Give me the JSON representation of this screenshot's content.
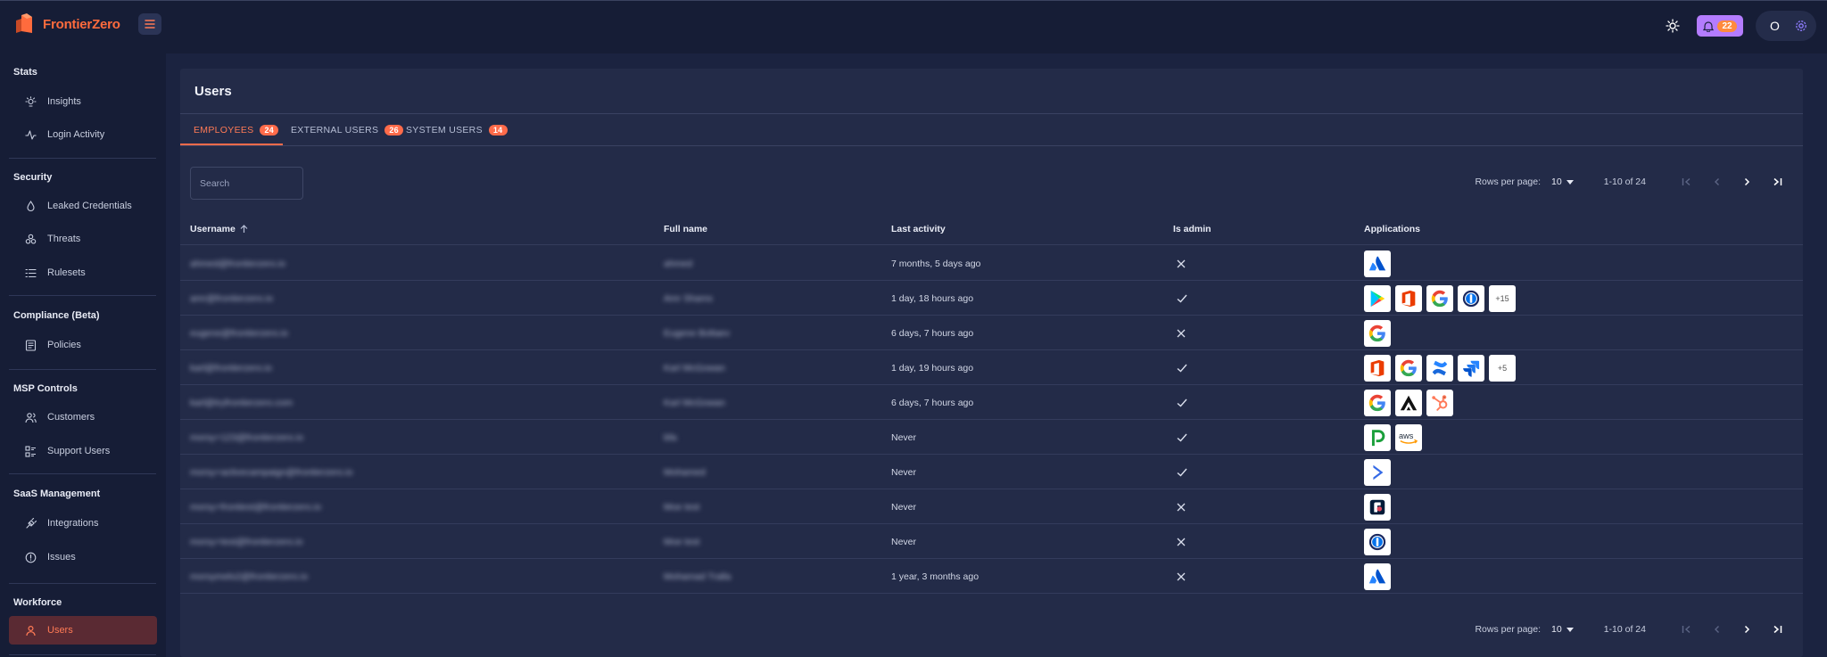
{
  "brand": {
    "name": "FrontierZero"
  },
  "header": {
    "notification_count": "22",
    "user_initial": "O"
  },
  "sidebar": {
    "sections": [
      {
        "title": "Stats",
        "items": [
          {
            "label": "Insights"
          },
          {
            "label": "Login Activity"
          }
        ]
      },
      {
        "title": "Security",
        "items": [
          {
            "label": "Leaked Credentials"
          },
          {
            "label": "Threats"
          },
          {
            "label": "Rulesets"
          }
        ]
      },
      {
        "title": "Compliance (Beta)",
        "items": [
          {
            "label": "Policies"
          }
        ]
      },
      {
        "title": "MSP Controls",
        "items": [
          {
            "label": "Customers"
          },
          {
            "label": "Support Users"
          }
        ]
      },
      {
        "title": "SaaS Management",
        "items": [
          {
            "label": "Integrations"
          },
          {
            "label": "Issues"
          }
        ]
      },
      {
        "title": "Workforce",
        "items": [
          {
            "label": "Users",
            "active": true
          }
        ]
      }
    ]
  },
  "page": {
    "title": "Users"
  },
  "tabs": [
    {
      "label": "EMPLOYEES",
      "count": "24",
      "active": true
    },
    {
      "label": "EXTERNAL USERS",
      "count": "26"
    },
    {
      "label": "SYSTEM USERS",
      "count": "14"
    }
  ],
  "search": {
    "placeholder": "Search"
  },
  "pagination": {
    "rows_per_page_label": "Rows per page:",
    "rows_per_page": "10",
    "range": "1-10 of 24"
  },
  "table": {
    "columns": [
      "Username",
      "Full name",
      "Last activity",
      "Is admin",
      "Applications"
    ],
    "rows": [
      {
        "username": "ahmed@frontierzero.io",
        "full_name": "ahmed",
        "last_activity": "7 months, 5 days ago",
        "is_admin": false,
        "apps": [
          "atlassian"
        ],
        "more": ""
      },
      {
        "username": "amr@frontierzero.io",
        "full_name": "Amr Shams",
        "last_activity": "1 day, 18 hours ago",
        "is_admin": true,
        "apps": [
          "google-play",
          "office",
          "google",
          "1password"
        ],
        "more": "+15"
      },
      {
        "username": "eugene@frontierzero.io",
        "full_name": "Eugene Boltaev",
        "last_activity": "6 days, 7 hours ago",
        "is_admin": false,
        "apps": [
          "google"
        ],
        "more": ""
      },
      {
        "username": "karl@frontierzero.io",
        "full_name": "Karl McGowan",
        "last_activity": "1 day, 19 hours ago",
        "is_admin": true,
        "apps": [
          "office",
          "google",
          "confluence",
          "jira"
        ],
        "more": "+5"
      },
      {
        "username": "karl@tryfrontierzero.com",
        "full_name": "Karl McGowan",
        "last_activity": "6 days, 7 hours ago",
        "is_admin": true,
        "apps": [
          "google",
          "arcade",
          "hubspot"
        ],
        "more": ""
      },
      {
        "username": "morsy+123@frontierzero.io",
        "full_name": "bfa",
        "last_activity": "Never",
        "is_admin": true,
        "apps": [
          "pipedrive",
          "aws"
        ],
        "more": ""
      },
      {
        "username": "morsy+activecampaign@frontierzero.io",
        "full_name": "Mohamed",
        "last_activity": "Never",
        "is_admin": true,
        "apps": [
          "activecampaign"
        ],
        "more": ""
      },
      {
        "username": "morsy+frontiest@frontierzero.io",
        "full_name": "Moe test",
        "last_activity": "Never",
        "is_admin": false,
        "apps": [
          "front"
        ],
        "more": ""
      },
      {
        "username": "morsy+test@frontierzero.io",
        "full_name": "Moe test",
        "last_activity": "Never",
        "is_admin": false,
        "apps": [
          "1password"
        ],
        "more": ""
      },
      {
        "username": "morsymelo2@frontierzero.io",
        "full_name": "Mohamad Tralla",
        "last_activity": "1 year, 3 months ago",
        "is_admin": false,
        "apps": [
          "atlassian"
        ],
        "more": ""
      }
    ]
  },
  "colors": {
    "accent": "#ff6b4a",
    "background": "#161d36",
    "card": "#232b48"
  }
}
